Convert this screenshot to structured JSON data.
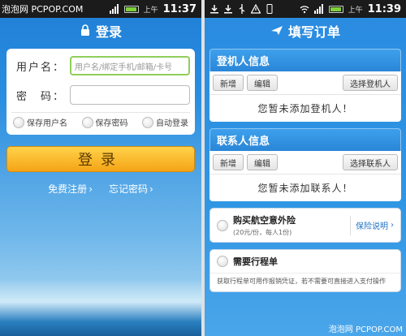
{
  "watermark_top": "泡泡网 PCPOP.COM",
  "watermark_bottom": "泡泡网 PCPOP.COM",
  "left": {
    "status": {
      "ampm": "上午",
      "time": "11:37"
    },
    "title": "登录",
    "username_label": "用户名：",
    "username_placeholder": "用户名/绑定手机/邮箱/卡号",
    "password_label": "密　码：",
    "checks": [
      "保存用户名",
      "保存密码",
      "自动登录"
    ],
    "login_button": "登录",
    "register_link": "免费注册",
    "forgot_link": "忘记密码",
    "chevron": "›"
  },
  "right": {
    "status": {
      "ampm": "上午",
      "time": "11:39"
    },
    "title": "填写订单",
    "passenger": {
      "header": "登机人信息",
      "add": "新增",
      "edit": "编辑",
      "select": "选择登机人",
      "empty": "您暂未添加登机人！"
    },
    "contact": {
      "header": "联系人信息",
      "add": "新增",
      "edit": "编辑",
      "select": "选择联系人",
      "empty": "您暂未添加联系人！"
    },
    "insurance": {
      "title": "购买航空意外险",
      "sub": "(20元/份，每人1份)",
      "link": "保险说明",
      "chevron": "›"
    },
    "itinerary": {
      "title": "需要行程单",
      "note": "获取行程单可用作报销凭证，若不需要可直接进入支付操作"
    }
  },
  "colors": {
    "accent": "#2a86d8",
    "login_button": "#f5a416",
    "focus": "#8fcf5a"
  }
}
